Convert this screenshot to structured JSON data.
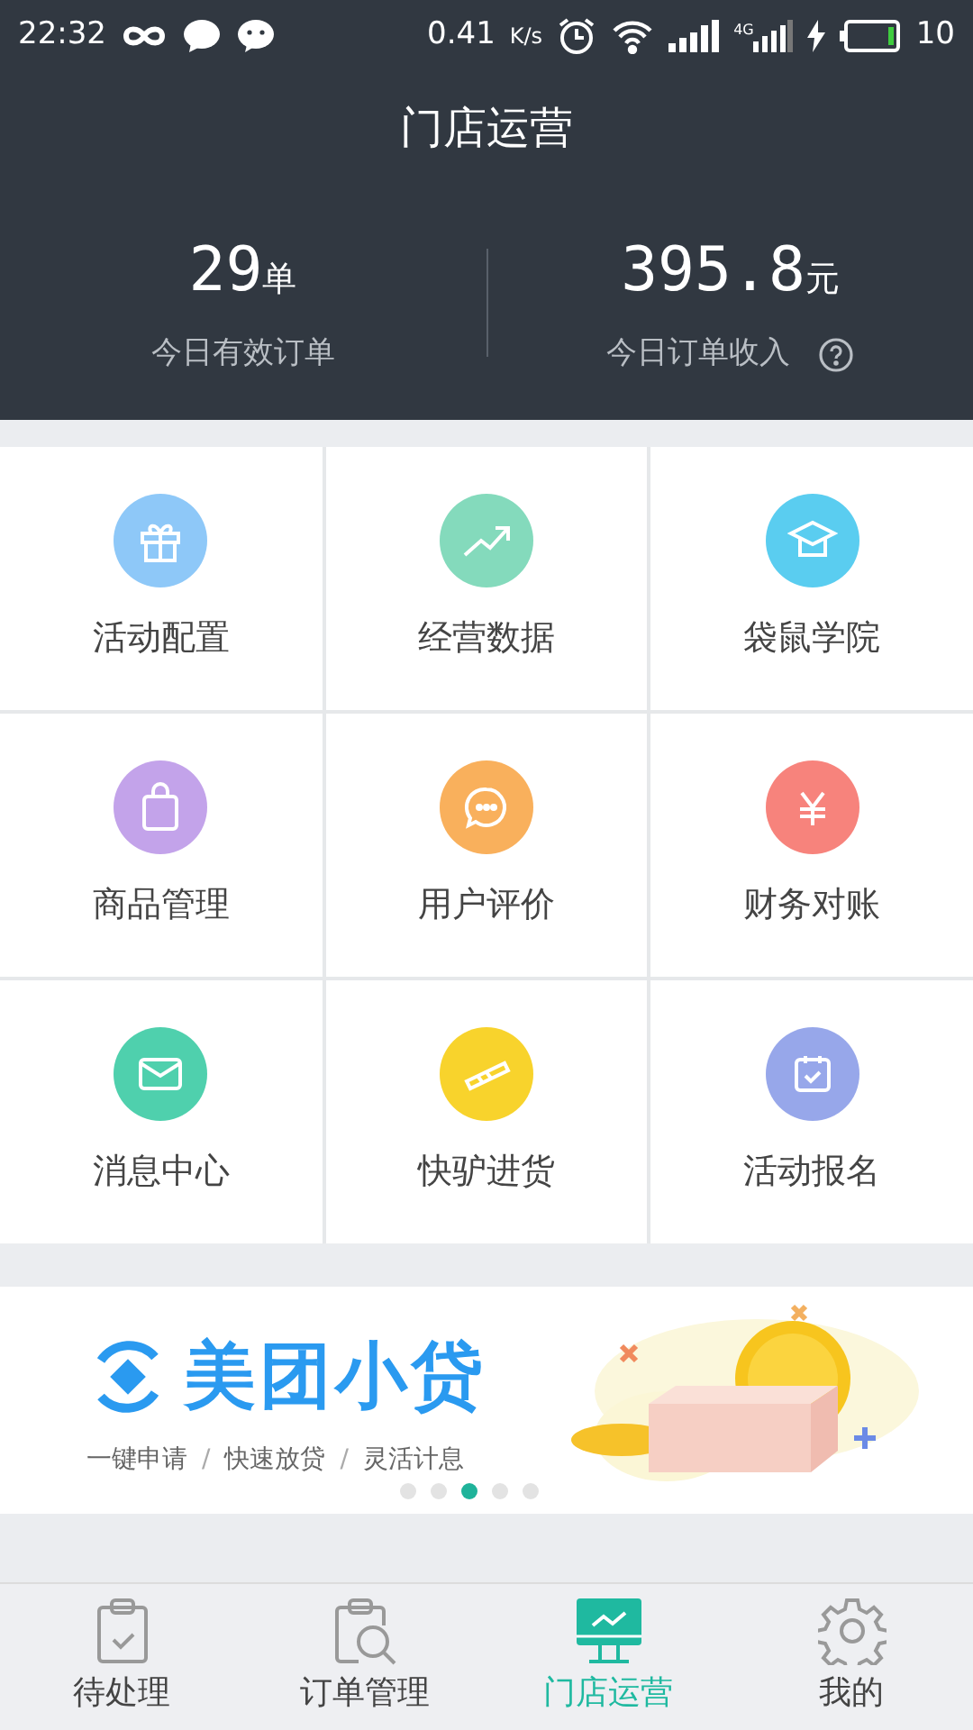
{
  "status_bar": {
    "time": "22:32",
    "speed": "0.41",
    "speed_unit": "K/s",
    "network": "4G",
    "battery": "10"
  },
  "header": {
    "title": "门店运营"
  },
  "stats": [
    {
      "value": "29",
      "unit": "单",
      "label": "今日有效订单",
      "help": false
    },
    {
      "value": "395.8",
      "unit": "元",
      "label": "今日订单收入",
      "help": true
    }
  ],
  "tiles": [
    {
      "label": "活动配置",
      "color": "#8ec8f8"
    },
    {
      "label": "经营数据",
      "color": "#84dabc"
    },
    {
      "label": "袋鼠学院",
      "color": "#5acdf0"
    },
    {
      "label": "商品管理",
      "color": "#c3a3ea"
    },
    {
      "label": "用户评价",
      "color": "#f9b05c"
    },
    {
      "label": "财务对账",
      "color": "#f7837c"
    },
    {
      "label": "消息中心",
      "color": "#4fd0ad"
    },
    {
      "label": "快驴进货",
      "color": "#f8d32c"
    },
    {
      "label": "活动报名",
      "color": "#97a7ea"
    }
  ],
  "banner": {
    "brand": "美团小贷",
    "taglines": [
      "一键申请",
      "快速放贷",
      "灵活计息"
    ],
    "separator": "/",
    "dots": [
      {
        "selected": false
      },
      {
        "selected": false
      },
      {
        "selected": true
      },
      {
        "selected": false
      },
      {
        "selected": false
      }
    ]
  },
  "tab_bar": [
    {
      "label": "待处理",
      "selected": false
    },
    {
      "label": "订单管理",
      "selected": false
    },
    {
      "label": "门店运营",
      "selected": true
    },
    {
      "label": "我的",
      "selected": false
    }
  ]
}
